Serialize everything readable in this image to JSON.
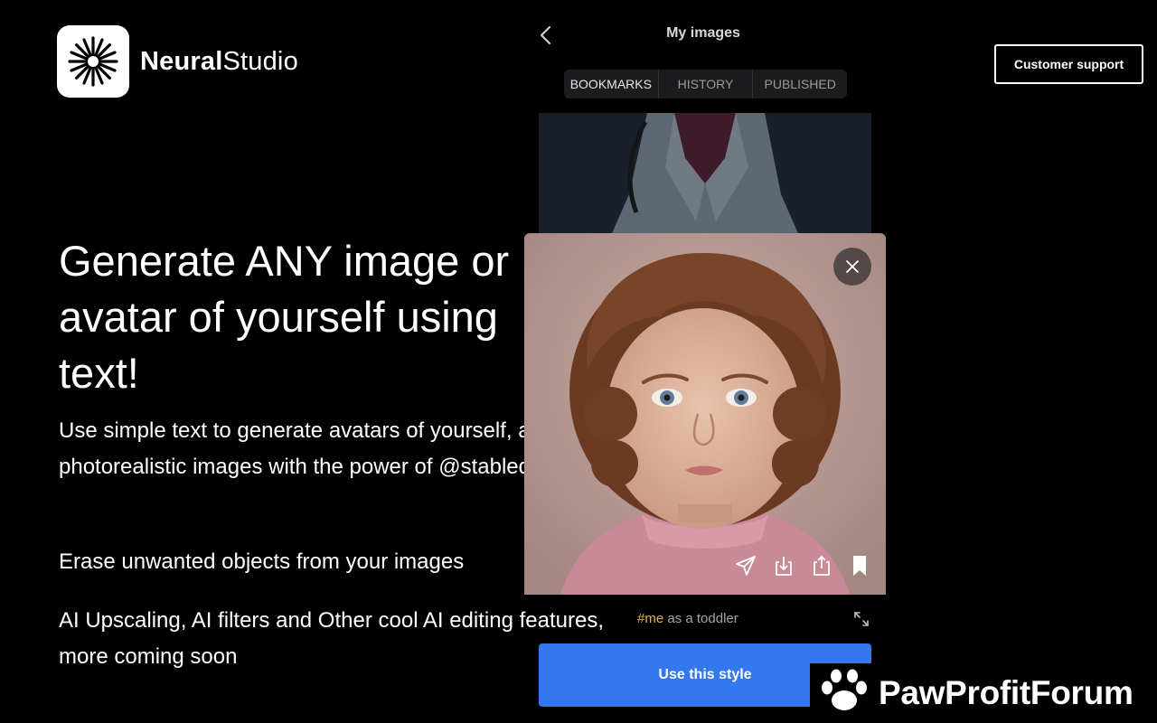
{
  "brand": {
    "name_bold": "Neural",
    "name_light": "Studio",
    "logo_icon": "asterisk-burst-icon"
  },
  "header": {
    "support_label": "Customer support"
  },
  "hero": {
    "title": "Generate ANY image or avatar of yourself using text!",
    "desc1": "Use simple text to generate avatars of yourself, art, logos and photorealistic images with the power of @stablediffusion",
    "desc2": "Erase unwanted objects from your images",
    "desc3": "AI Upscaling, AI filters and Other cool AI editing features, more coming soon"
  },
  "app_screen": {
    "title": "My images",
    "tabs": [
      {
        "label": "BOOKMARKS",
        "active": true
      },
      {
        "label": "HISTORY",
        "active": false
      },
      {
        "label": "PUBLISHED",
        "active": false
      }
    ],
    "prompt_tag": "#me",
    "prompt_text": " as a toddler",
    "use_style_label": "Use this style"
  },
  "watermark": {
    "text": "PawProfitForum"
  },
  "colors": {
    "background": "#000000",
    "accent_blue": "#3478f0",
    "tag_yellow": "#e2b548"
  }
}
